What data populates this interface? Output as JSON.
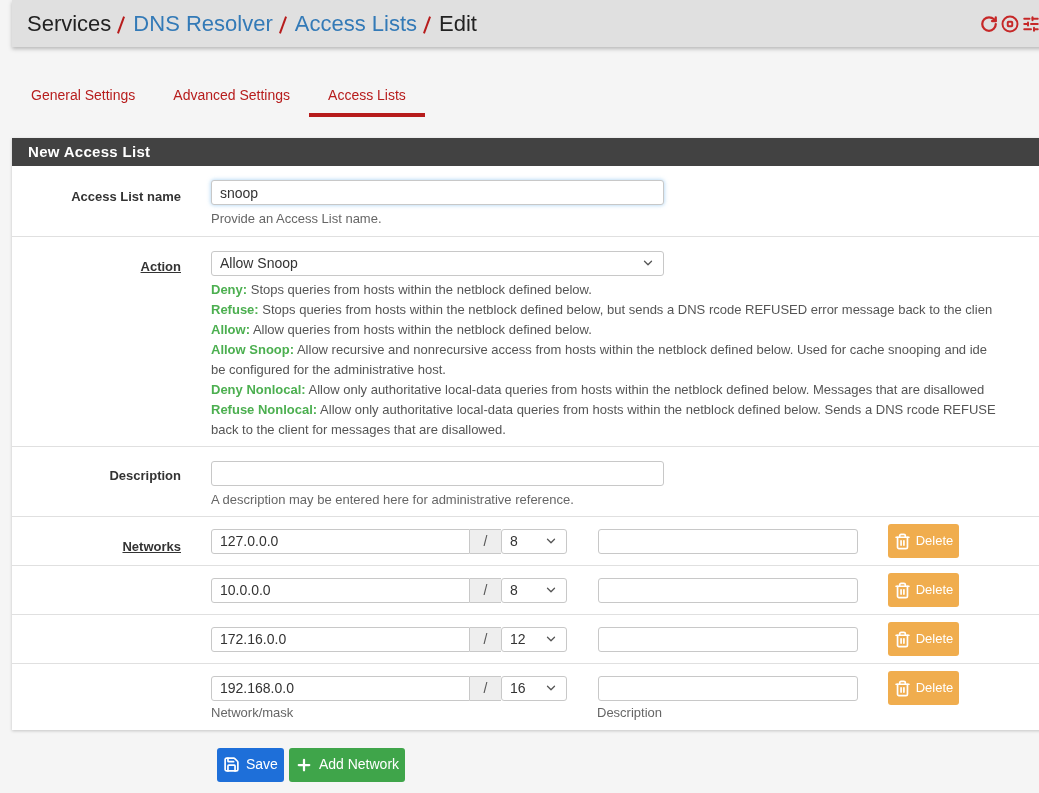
{
  "breadcrumb": [
    {
      "label": "Services",
      "link": false
    },
    {
      "label": "DNS Resolver",
      "link": true
    },
    {
      "label": "Access Lists",
      "link": true
    },
    {
      "label": "Edit",
      "link": false
    }
  ],
  "tabs": [
    {
      "label": "General Settings",
      "selected": false
    },
    {
      "label": "Advanced Settings",
      "selected": false
    },
    {
      "label": "Access Lists",
      "selected": true
    }
  ],
  "panel": {
    "title": "New Access List",
    "name_field": {
      "label": "Access List name",
      "value": "snoop",
      "help": "Provide an Access List name."
    },
    "action": {
      "label": "Action",
      "value": "Allow Snoop",
      "help": [
        "**Deny:** Stops queries from hosts within the netblock defined below.",
        "**Refuse:** Stops queries from hosts within the netblock defined below, but sends a DNS rcode REFUSED error message back to the clien",
        "**Allow:** Allow queries from hosts within the netblock defined below.",
        "**Allow Snoop:** Allow recursive and nonrecursive access from hosts within the netblock defined below. Used for cache snooping and ide",
        "be configured for the administrative host.",
        "**Deny Nonlocal:** Allow only authoritative local-data queries from hosts within the netblock defined below. Messages that are disallowed",
        "**Refuse Nonlocal:** Allow only authoritative local-data queries from hosts within the netblock defined below. Sends a DNS rcode REFUSE",
        "back to the client for messages that are disallowed."
      ]
    },
    "description": {
      "label": "Description",
      "help": "A description may be entered here for administrative reference."
    },
    "networks": {
      "label": "Networks",
      "separator": "/",
      "rows": [
        {
          "address": "127.0.0.0",
          "mask": "8",
          "delete_label": "Delete"
        },
        {
          "address": "10.0.0.0",
          "mask": "8",
          "delete_label": "Delete"
        },
        {
          "address": "172.16.0.0",
          "mask": "12",
          "delete_label": "Delete"
        },
        {
          "address": "192.168.0.0",
          "mask": "16",
          "delete_label": "Delete"
        }
      ],
      "address_help": "Network/mask",
      "description_help": "Description"
    }
  },
  "buttons": [
    {
      "kind": "save",
      "label": "Save"
    },
    {
      "kind": "add",
      "label": "Add Network"
    }
  ]
}
